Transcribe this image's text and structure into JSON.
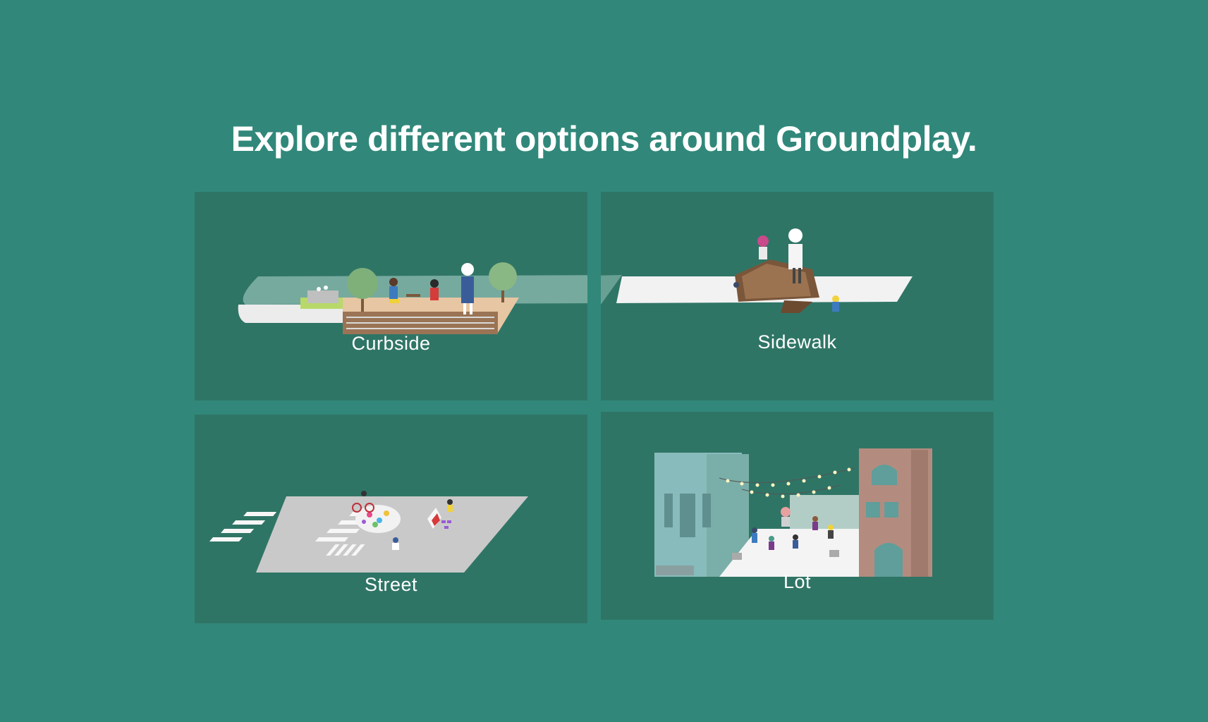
{
  "page": {
    "headline": "Explore different options around Groundplay."
  },
  "options": [
    {
      "label": "Curbside"
    },
    {
      "label": "Sidewalk"
    },
    {
      "label": "Street"
    },
    {
      "label": "Lot"
    }
  ],
  "colors": {
    "background": "#31887a",
    "card": "#2f7566",
    "text": "#ffffff"
  }
}
